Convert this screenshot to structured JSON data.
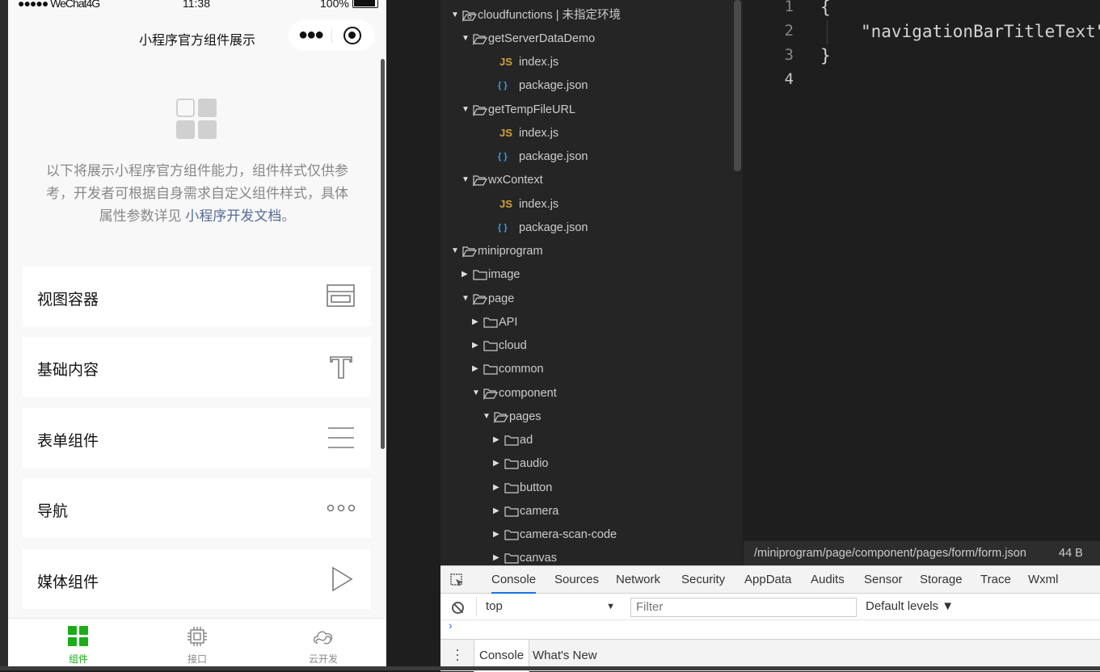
{
  "status_bar": {
    "signal": "●●●●● WeChat4G",
    "time": "11:38",
    "battery": "100%"
  },
  "nav": {
    "title": "小程序官方组件展示"
  },
  "intro": {
    "text": "以下将展示小程序官方组件能力，组件样式仅供参考，开发者可根据自身需求自定义组件样式，具体属性参数详见 ",
    "link": "小程序开发文档",
    "end": "。"
  },
  "cards": [
    {
      "label": "视图容器",
      "icon": "view-container-icon"
    },
    {
      "label": "基础内容",
      "icon": "text-icon"
    },
    {
      "label": "表单组件",
      "icon": "list-lines-icon"
    },
    {
      "label": "导航",
      "icon": "dots-icon"
    },
    {
      "label": "媒体组件",
      "icon": "play-icon"
    }
  ],
  "tabbar": {
    "tabs": [
      {
        "label": "组件"
      },
      {
        "label": "接口"
      },
      {
        "label": "云开发"
      }
    ],
    "active_color": "#1aad19"
  },
  "tree": {
    "rows": [
      {
        "name": "cloudfunctions | 未指定环境",
        "kind": "cloud-folder",
        "open": true
      },
      {
        "name": "getServerDataDemo",
        "kind": "folder",
        "open": true
      },
      {
        "name": "index.js",
        "kind": "js"
      },
      {
        "name": "package.json",
        "kind": "json"
      },
      {
        "name": "getTempFileURL",
        "kind": "folder",
        "open": true
      },
      {
        "name": "index.js",
        "kind": "js"
      },
      {
        "name": "package.json",
        "kind": "json"
      },
      {
        "name": "wxContext",
        "kind": "folder",
        "open": true
      },
      {
        "name": "index.js",
        "kind": "js"
      },
      {
        "name": "package.json",
        "kind": "json"
      },
      {
        "name": "miniprogram",
        "kind": "folder",
        "open": true
      },
      {
        "name": "image",
        "kind": "folder",
        "open": false
      },
      {
        "name": "page",
        "kind": "folder",
        "open": true
      },
      {
        "name": "API",
        "kind": "folder",
        "open": false
      },
      {
        "name": "cloud",
        "kind": "folder",
        "open": false
      },
      {
        "name": "common",
        "kind": "folder",
        "open": false
      },
      {
        "name": "component",
        "kind": "folder",
        "open": true
      },
      {
        "name": "pages",
        "kind": "folder",
        "open": true
      },
      {
        "name": "ad",
        "kind": "folder",
        "open": false
      },
      {
        "name": "audio",
        "kind": "folder",
        "open": false
      },
      {
        "name": "button",
        "kind": "folder",
        "open": false
      },
      {
        "name": "camera",
        "kind": "folder",
        "open": false
      },
      {
        "name": "camera-scan-code",
        "kind": "folder",
        "open": false
      },
      {
        "name": "canvas",
        "kind": "folder",
        "open": false
      }
    ]
  },
  "editor": {
    "lines": [
      {
        "num": "1",
        "text": "{"
      },
      {
        "num": "2",
        "text": "\"navigationBarTitleText\""
      },
      {
        "num": "3",
        "text": "}"
      },
      {
        "num": "4",
        "text": ""
      }
    ],
    "path": "/miniprogram/page/component/pages/form/form.json",
    "size": "44 B"
  },
  "devtools": {
    "tabs": [
      "Console",
      "Sources",
      "Network",
      "Security",
      "AppData",
      "Audits",
      "Sensor",
      "Storage",
      "Trace",
      "Wxml"
    ],
    "context": "top",
    "filter_placeholder": "Filter",
    "levels": "Default levels ▼",
    "drawer_tabs": [
      "Console",
      "What's New"
    ]
  }
}
